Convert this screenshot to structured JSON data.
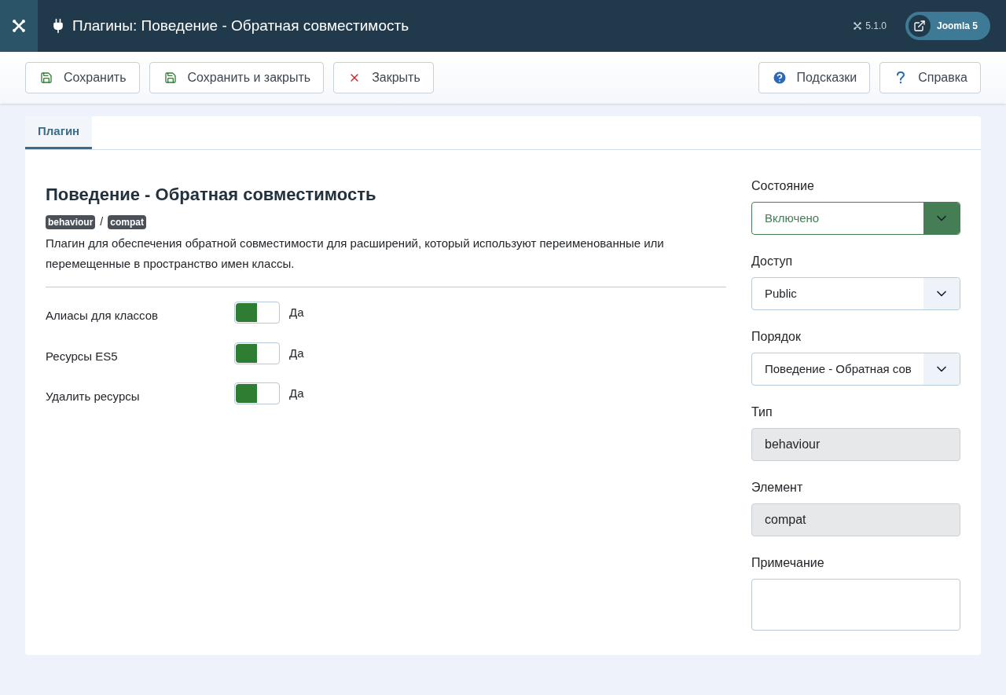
{
  "header": {
    "title": "Плагины: Поведение - Обратная совместимость",
    "version": "5.1.0",
    "site_button": "Joomla 5"
  },
  "toolbar": {
    "left": [
      {
        "label": "Сохранить",
        "kind": "save"
      },
      {
        "label": "Сохранить и закрыть",
        "kind": "save"
      },
      {
        "label": "Закрыть",
        "kind": "close"
      }
    ],
    "right": [
      {
        "label": "Подсказки",
        "kind": "hints"
      },
      {
        "label": "Справка",
        "kind": "help"
      }
    ]
  },
  "tabs": [
    {
      "label": "Плагин",
      "selected": true
    }
  ],
  "plugin": {
    "title": "Поведение - Обратная совместимость",
    "badges": [
      "behaviour",
      "compat"
    ],
    "separator": "/",
    "description": "Плагин для обеспечения обратной совместимости для расширений, который используют переименованные или перемещенные в пространство имен классы."
  },
  "options": [
    {
      "label": "Алиасы для классов",
      "on": true,
      "value": "Да"
    },
    {
      "label": "Ресурсы ES5",
      "on": true,
      "value": "Да"
    },
    {
      "label": "Удалить ресурсы",
      "on": true,
      "value": "Да"
    }
  ],
  "sidebar": [
    {
      "label": "Состояние",
      "kind": "select",
      "value": "Включено",
      "published": true
    },
    {
      "label": "Доступ",
      "kind": "select",
      "value": "Public",
      "published": false
    },
    {
      "label": "Порядок",
      "kind": "select",
      "value": "Поведение - Обратная сов",
      "published": false
    },
    {
      "label": "Тип",
      "kind": "readonly",
      "value": "behaviour"
    },
    {
      "label": "Элемент",
      "kind": "readonly",
      "value": "compat"
    },
    {
      "label": "Примечание",
      "kind": "textarea"
    }
  ]
}
